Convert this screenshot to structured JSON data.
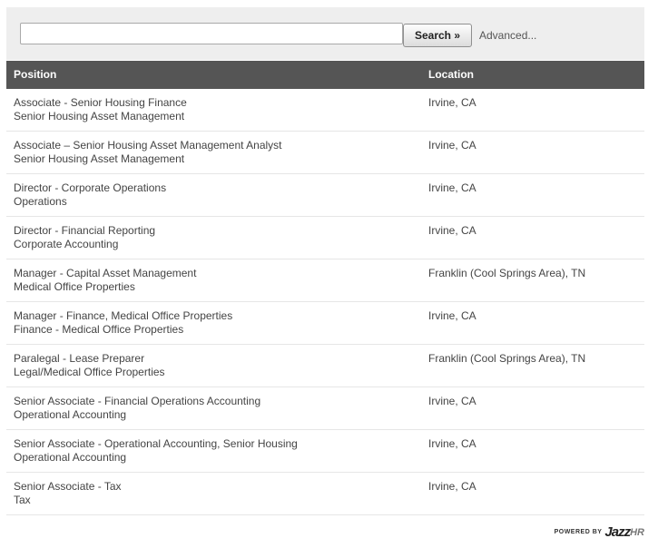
{
  "search": {
    "input_value": "",
    "input_placeholder": "",
    "button_label": "Search »",
    "advanced_label": "Advanced..."
  },
  "table": {
    "headers": {
      "position": "Position",
      "location": "Location"
    },
    "rows": [
      {
        "title": "Associate - Senior Housing Finance",
        "department": "Senior Housing Asset Management",
        "location": "Irvine, CA"
      },
      {
        "title": "Associate – Senior Housing Asset Management Analyst",
        "department": "Senior Housing Asset Management",
        "location": "Irvine, CA"
      },
      {
        "title": "Director - Corporate Operations",
        "department": "Operations",
        "location": "Irvine, CA"
      },
      {
        "title": "Director - Financial Reporting",
        "department": "Corporate Accounting",
        "location": "Irvine, CA"
      },
      {
        "title": "Manager - Capital Asset Management",
        "department": "Medical Office Properties",
        "location": "Franklin (Cool Springs Area), TN"
      },
      {
        "title": "Manager - Finance, Medical Office Properties",
        "department": "Finance - Medical Office Properties",
        "location": "Irvine, CA"
      },
      {
        "title": "Paralegal - Lease Preparer",
        "department": "Legal/Medical Office Properties",
        "location": "Franklin (Cool Springs Area), TN"
      },
      {
        "title": "Senior Associate - Financial Operations Accounting",
        "department": "Operational Accounting",
        "location": "Irvine, CA"
      },
      {
        "title": "Senior Associate - Operational Accounting, Senior Housing",
        "department": "Operational Accounting",
        "location": "Irvine, CA"
      },
      {
        "title": "Senior Associate - Tax",
        "department": "Tax",
        "location": "Irvine, CA"
      }
    ]
  },
  "footer": {
    "powered_by": "POWERED BY",
    "brand_main": "Jazz",
    "brand_suffix": "HR"
  },
  "colors": {
    "header_bg": "#555555",
    "searchbar_bg": "#eeeeee",
    "text": "#444444"
  }
}
